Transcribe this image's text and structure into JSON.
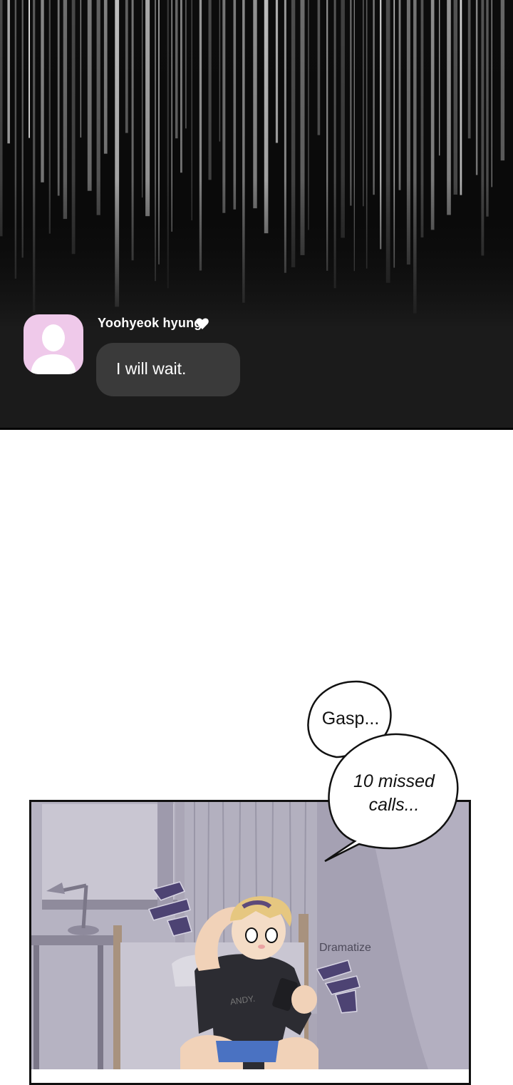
{
  "message": {
    "sender_name": "Yoohyeok hyung",
    "text": "I will wait."
  },
  "balloons": {
    "gasp": "Gasp...",
    "missed_calls": "10 missed calls..."
  },
  "sfx": {
    "dramatize_label": "Dramatize"
  },
  "icons": {
    "avatar": "person-placeholder-icon",
    "heart": "heart-icon"
  },
  "colors": {
    "dark_bg": "#1b1b1b",
    "bubble_bg": "#3a3a3a",
    "avatar_bg": "#efc9ea",
    "sfx_purple": "#4d4373"
  }
}
